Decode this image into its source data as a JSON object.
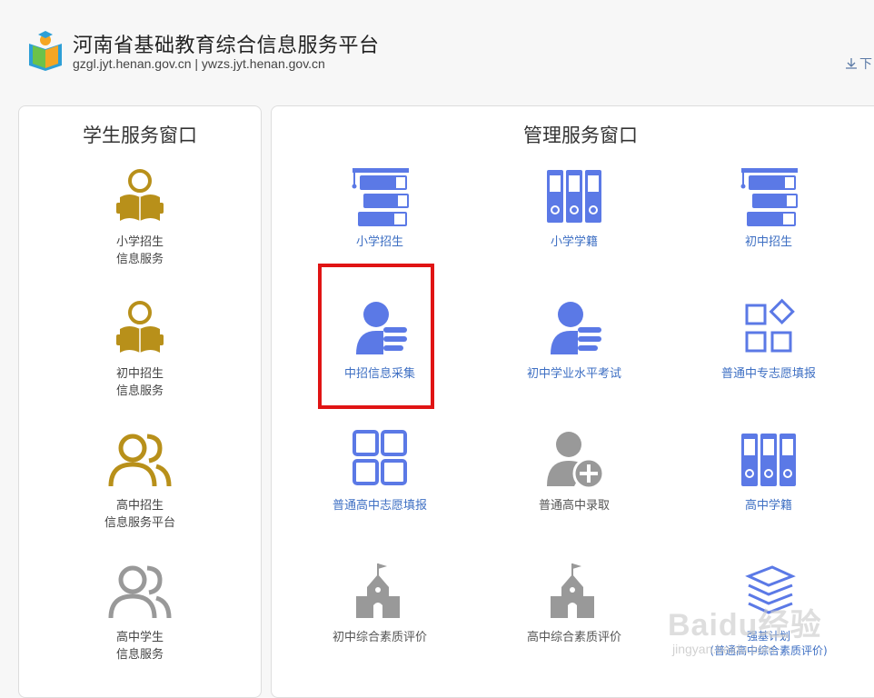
{
  "header": {
    "title": "河南省基础教育综合信息服务平台",
    "domains": "gzgl.jyt.henan.gov.cn | ywzs.jyt.henan.gov.cn",
    "download_label": "下"
  },
  "student_panel": {
    "title": "学生服务窗口",
    "items": [
      {
        "label": "小学招生\n信息服务",
        "icon": "reading-student-icon"
      },
      {
        "label": "初中招生\n信息服务",
        "icon": "reading-student-icon"
      },
      {
        "label": "高中招生\n信息服务平台",
        "icon": "users-outline-icon"
      },
      {
        "label": "高中学生\n信息服务",
        "icon": "users-outline-icon"
      }
    ]
  },
  "admin_panel": {
    "title": "管理服务窗口",
    "items": [
      {
        "label": "小学招生",
        "icon": "books-grad-cap-icon"
      },
      {
        "label": "小学学籍",
        "icon": "binders-icon"
      },
      {
        "label": "初中招生",
        "icon": "books-grad-cap-icon"
      },
      {
        "label": "中招信息采集",
        "icon": "user-list-icon"
      },
      {
        "label": "初中学业水平考试",
        "icon": "user-list-icon"
      },
      {
        "label": "普通中专志愿填报",
        "icon": "apps-shapes-icon"
      },
      {
        "label": "普通高中志愿填报",
        "icon": "grid-squares-icon"
      },
      {
        "label": "普通高中录取",
        "icon": "user-add-icon"
      },
      {
        "label": "高中学籍",
        "icon": "binders-icon"
      },
      {
        "label": "初中综合素质评价",
        "icon": "school-building-icon"
      },
      {
        "label": "高中综合素质评价",
        "icon": "school-building-icon"
      },
      {
        "label": "强基计划\n(普通高中综合素质评价)",
        "icon": "layers-icon"
      }
    ]
  },
  "colors": {
    "accent_blue": "#5b79e6",
    "gold": "#b8901a",
    "gray_icon": "#999999",
    "highlight": "#e01414"
  },
  "watermark": {
    "main": "Baidu经验",
    "sub": "jingyan.baidu.com"
  }
}
